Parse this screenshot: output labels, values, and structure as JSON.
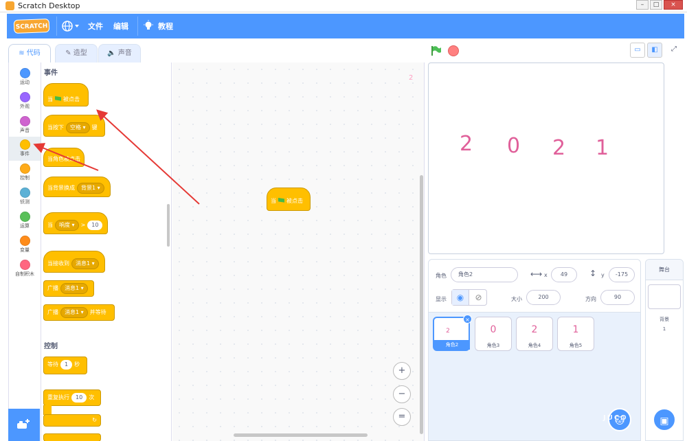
{
  "window": {
    "title": "Scratch Desktop"
  },
  "menubar": {
    "logo": "SCRATCH",
    "file": "文件",
    "edit": "编辑",
    "tutorials": "教程"
  },
  "tabs": [
    {
      "label": "代码"
    },
    {
      "label": "造型"
    },
    {
      "label": "声音"
    }
  ],
  "categories": [
    {
      "label": "运动",
      "color": "#4c97ff"
    },
    {
      "label": "外观",
      "color": "#9966ff"
    },
    {
      "label": "声音",
      "color": "#cf63cf"
    },
    {
      "label": "事件",
      "color": "#ffbf00"
    },
    {
      "label": "控制",
      "color": "#ffab19"
    },
    {
      "label": "侦测",
      "color": "#5cb1d6"
    },
    {
      "label": "运算",
      "color": "#59c059"
    },
    {
      "label": "变量",
      "color": "#ff8c1a"
    },
    {
      "label": "自制积木",
      "color": "#ff6680"
    }
  ],
  "palette": {
    "events_title": "事件",
    "control_title": "控制",
    "blocks": {
      "when_flag_when": "当",
      "when_flag_clicked": "被点击",
      "when_key_pre": "当按下",
      "when_key_dropdown": "空格 ▾",
      "when_key_post": "键",
      "when_sprite_clicked": "当角色被点击",
      "when_backdrop_pre": "当背景换成",
      "when_backdrop_dropdown": "背景1 ▾",
      "when_loudness_pre": "当",
      "when_loudness_dropdown": "响度 ▾",
      "when_loudness_op": ">",
      "when_loudness_value": "10",
      "when_receive_pre": "当接收到",
      "when_receive_dropdown": "消息1 ▾",
      "broadcast_pre": "广播",
      "broadcast_dropdown": "消息1 ▾",
      "broadcast_wait_pre": "广播",
      "broadcast_wait_dropdown": "消息1 ▾",
      "broadcast_wait_post": "并等待",
      "wait_pre": "等待",
      "wait_value": "1",
      "wait_post": "秒",
      "repeat_pre": "重复执行",
      "repeat_value": "10",
      "repeat_post": "次",
      "repeat_arrow": "↻"
    }
  },
  "workspace": {
    "badge": "2",
    "script_block_when": "当",
    "script_block_clicked": "被点击",
    "zoom_in": "+",
    "zoom_out": "−",
    "zoom_reset": "="
  },
  "stage": {
    "numbers": [
      "2",
      "0",
      "2",
      "1"
    ]
  },
  "sprite_info": {
    "sprite_label": "角色",
    "sprite_name": "角色2",
    "x_label": "x",
    "x_value": "49",
    "y_label": "y",
    "y_value": "-175",
    "show_label": "显示",
    "size_label": "大小",
    "size_value": "200",
    "direction_label": "方向",
    "direction_value": "90"
  },
  "sprites": [
    {
      "thumb": "2",
      "name": "角色2"
    },
    {
      "thumb": "0",
      "name": "角色3"
    },
    {
      "thumb": "2",
      "name": "角色4"
    },
    {
      "thumb": "1",
      "name": "角色5"
    }
  ],
  "stage_panel": {
    "title": "舞台",
    "backdrops_label": "背景",
    "backdrops_count": "1"
  },
  "watermark": "JUCO"
}
